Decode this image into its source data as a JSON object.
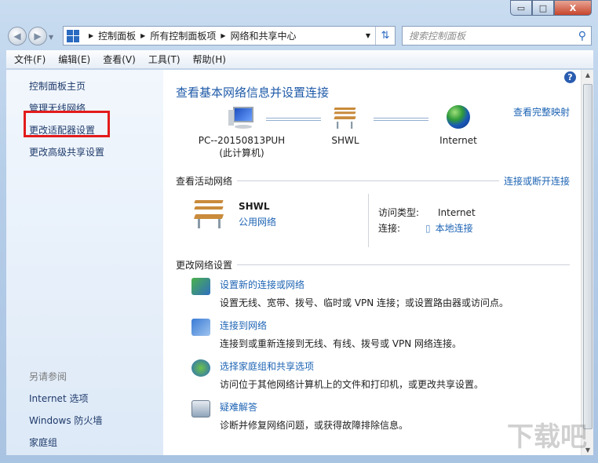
{
  "window": {
    "minimize": "▭",
    "maximize": "□",
    "close": "X"
  },
  "address": {
    "crumbs": [
      "控制面板",
      "所有控制面板项",
      "网络和共享中心"
    ],
    "search_placeholder": "搜索控制面板"
  },
  "menu": [
    "文件(F)",
    "编辑(E)",
    "查看(V)",
    "工具(T)",
    "帮助(H)"
  ],
  "sidebar": {
    "items": [
      "控制面板主页",
      "管理无线网络",
      "更改适配器设置",
      "更改高级共享设置"
    ],
    "see_also_heading": "另请参阅",
    "see_also": [
      "Internet 选项",
      "Windows 防火墙",
      "家庭组"
    ]
  },
  "main": {
    "title": "查看基本网络信息并设置连接",
    "view_full_map": "查看完整映射",
    "nodes": {
      "pc": "PC--20150813PUH",
      "pc_sub": "(此计算机)",
      "network": "SHWL",
      "internet": "Internet"
    },
    "active_heading": "查看活动网络",
    "connect_disconnect": "连接或断开连接",
    "active": {
      "name": "SHWL",
      "type": "公用网络",
      "access_label": "访问类型:",
      "access_value": "Internet",
      "conn_label": "连接:",
      "conn_value": "本地连接"
    },
    "change_heading": "更改网络设置",
    "tasks": [
      {
        "link": "设置新的连接或网络",
        "desc": "设置无线、宽带、拨号、临时或 VPN 连接；或设置路由器或访问点。"
      },
      {
        "link": "连接到网络",
        "desc": "连接到或重新连接到无线、有线、拨号或 VPN 网络连接。"
      },
      {
        "link": "选择家庭组和共享选项",
        "desc": "访问位于其他网络计算机上的文件和打印机，或更改共享设置。"
      },
      {
        "link": "疑难解答",
        "desc": "诊断并修复网络问题，或获得故障排除信息。"
      }
    ]
  },
  "watermark": "下载吧"
}
